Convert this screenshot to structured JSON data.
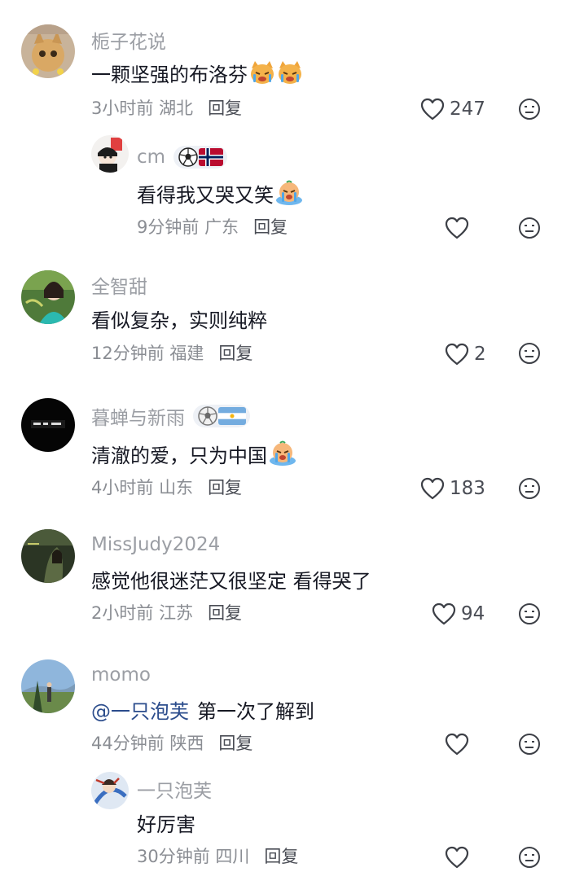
{
  "comments": [
    {
      "name": "栀子花说",
      "text": "一颗坚强的布洛芬",
      "time": "3小时前",
      "location": "湖北",
      "reply": "回复",
      "likes": "247",
      "badges": [],
      "emojis": [
        "cat-crying-emoji",
        "cat-crying-emoji"
      ]
    },
    {
      "name": "cm",
      "text": "看得我又哭又笑",
      "time": "9分钟前",
      "location": "广东",
      "reply": "回复",
      "likes": "",
      "badges": [
        "soccer-ball-icon",
        "norway-flag-icon"
      ],
      "emojis": [
        "crying-emoji"
      ]
    },
    {
      "name": "全智甜",
      "text": "看似复杂，实则纯粹",
      "time": "12分钟前",
      "location": "福建",
      "reply": "回复",
      "likes": "2",
      "badges": [],
      "emojis": []
    },
    {
      "name": "暮蝉与新雨",
      "text": "清澈的爱，只为中国",
      "time": "4小时前",
      "location": "山东",
      "reply": "回复",
      "likes": "183",
      "badges": [
        "soccer-ball-icon",
        "argentina-flag-icon"
      ],
      "emojis": [
        "crying-emoji"
      ]
    },
    {
      "name": "MissJudy2024",
      "text": "感觉他很迷茫又很坚定 看得哭了",
      "time": "2小时前",
      "location": "江苏",
      "reply": "回复",
      "likes": "94",
      "badges": [],
      "emojis": []
    },
    {
      "name": "momo",
      "mention": "@一只泡芙",
      "text": "第一次了解到",
      "time": "44分钟前",
      "location": "陕西",
      "reply": "回复",
      "likes": "",
      "badges": [],
      "emojis": []
    },
    {
      "name": "一只泡芙",
      "text": "好厉害",
      "time": "30分钟前",
      "location": "四川",
      "reply": "回复",
      "likes": "",
      "badges": [],
      "emojis": []
    }
  ],
  "colors": {
    "name": "#9b9ea4",
    "text": "#161823",
    "meta": "#8a8d93",
    "mention": "#2b4c8c"
  }
}
